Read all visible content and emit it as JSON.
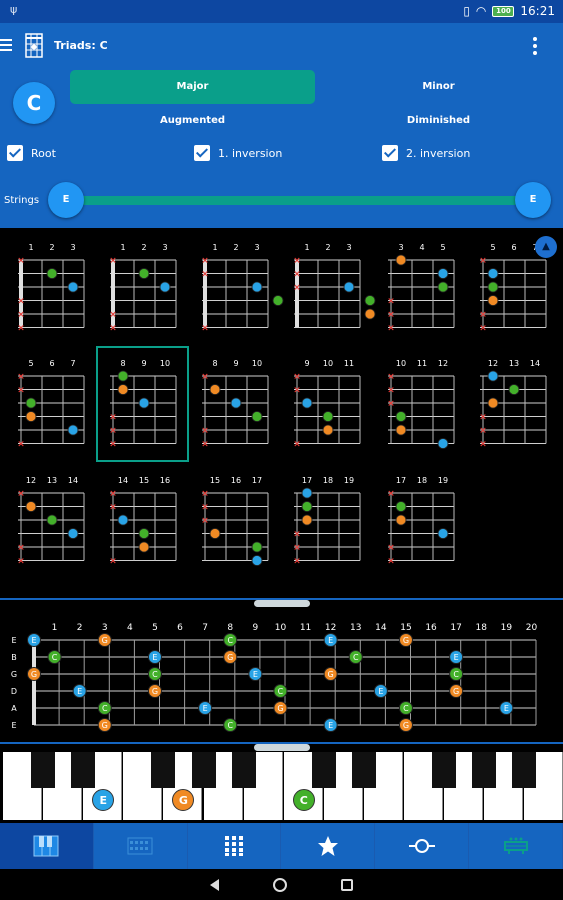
{
  "status": {
    "time": "16:21",
    "battery": "100"
  },
  "toolbar": {
    "title": "Triads: C"
  },
  "root_note": "C",
  "chord_types": [
    {
      "label": "Major",
      "active": true
    },
    {
      "label": "Minor",
      "active": false
    },
    {
      "label": "Augmented",
      "active": false
    },
    {
      "label": "Diminished",
      "active": false
    }
  ],
  "options": [
    {
      "label": "Root",
      "checked": true
    },
    {
      "label": "1. inversion",
      "checked": true
    },
    {
      "label": "2. inversion",
      "checked": true
    }
  ],
  "strings": {
    "label": "Strings",
    "from": "E",
    "to": "E"
  },
  "colors": {
    "root": "#43b02a",
    "third": "#29a3e6",
    "fifth": "#f08a24",
    "muted": "#e53935",
    "accent": "#0a9f8a",
    "primary": "#1565c0"
  },
  "diagrams": [
    {
      "frets": [
        "1",
        "2",
        "3"
      ],
      "muted": [
        0,
        3,
        4,
        5
      ],
      "nut": true,
      "dots": [
        [
          1,
          1,
          "C"
        ],
        [
          2,
          2,
          "E"
        ]
      ]
    },
    {
      "frets": [
        "1",
        "2",
        "3"
      ],
      "muted": [
        0,
        4,
        5
      ],
      "nut": true,
      "dots": [
        [
          1,
          1,
          "C"
        ],
        [
          2,
          2,
          "E"
        ]
      ]
    },
    {
      "frets": [
        "1",
        "2",
        "3"
      ],
      "muted": [
        0,
        1,
        5
      ],
      "nut": true,
      "dots": [
        [
          2,
          2,
          "E"
        ],
        [
          3,
          3,
          "C"
        ]
      ]
    },
    {
      "frets": [
        "1",
        "2",
        "3"
      ],
      "muted": [
        0,
        1,
        2
      ],
      "nut": true,
      "dots": [
        [
          2,
          2,
          "E"
        ],
        [
          3,
          3,
          "C"
        ],
        [
          4,
          3,
          "G"
        ]
      ]
    },
    {
      "frets": [
        "3",
        "4",
        "5"
      ],
      "muted": [
        3,
        4,
        5
      ],
      "nut": false,
      "dots": [
        [
          0,
          0,
          "G"
        ],
        [
          1,
          2,
          "E"
        ],
        [
          2,
          2,
          "C"
        ]
      ]
    },
    {
      "frets": [
        "5",
        "6",
        "7"
      ],
      "muted": [
        0,
        4,
        5
      ],
      "nut": false,
      "dots": [
        [
          1,
          0,
          "E"
        ],
        [
          2,
          0,
          "C"
        ],
        [
          3,
          0,
          "G"
        ]
      ]
    },
    {
      "frets": [
        "5",
        "6",
        "7"
      ],
      "muted": [
        0,
        1,
        5
      ],
      "nut": false,
      "dots": [
        [
          2,
          0,
          "C"
        ],
        [
          3,
          0,
          "G"
        ],
        [
          4,
          2,
          "E"
        ]
      ]
    },
    {
      "frets": [
        "8",
        "9",
        "10"
      ],
      "muted": [
        3,
        4,
        5
      ],
      "nut": false,
      "dots": [
        [
          0,
          0,
          "C"
        ],
        [
          1,
          0,
          "G"
        ],
        [
          2,
          1,
          "E"
        ]
      ],
      "selected": true
    },
    {
      "frets": [
        "8",
        "9",
        "10"
      ],
      "muted": [
        0,
        4,
        5
      ],
      "nut": false,
      "dots": [
        [
          1,
          0,
          "G"
        ],
        [
          2,
          1,
          "E"
        ],
        [
          3,
          2,
          "C"
        ]
      ]
    },
    {
      "frets": [
        "9",
        "10",
        "11"
      ],
      "muted": [
        0,
        1,
        5
      ],
      "nut": false,
      "dots": [
        [
          2,
          0,
          "E"
        ],
        [
          3,
          1,
          "C"
        ],
        [
          4,
          1,
          "G"
        ]
      ]
    },
    {
      "frets": [
        "10",
        "11",
        "12"
      ],
      "muted": [
        0,
        1,
        2
      ],
      "nut": false,
      "dots": [
        [
          3,
          0,
          "C"
        ],
        [
          4,
          0,
          "G"
        ],
        [
          5,
          2,
          "E"
        ]
      ]
    },
    {
      "frets": [
        "12",
        "13",
        "14"
      ],
      "muted": [
        3,
        4,
        5
      ],
      "nut": false,
      "dots": [
        [
          0,
          0,
          "E"
        ],
        [
          1,
          1,
          "C"
        ],
        [
          2,
          0,
          "G"
        ]
      ]
    },
    {
      "frets": [
        "12",
        "13",
        "14"
      ],
      "muted": [
        0,
        4,
        5
      ],
      "nut": false,
      "dots": [
        [
          1,
          0,
          "G"
        ],
        [
          2,
          1,
          "C"
        ],
        [
          3,
          2,
          "E"
        ]
      ]
    },
    {
      "frets": [
        "14",
        "15",
        "16"
      ],
      "muted": [
        0,
        1,
        5
      ],
      "nut": false,
      "dots": [
        [
          2,
          0,
          "E"
        ],
        [
          3,
          1,
          "C"
        ],
        [
          4,
          1,
          "G"
        ]
      ]
    },
    {
      "frets": [
        "15",
        "16",
        "17"
      ],
      "muted": [
        0,
        1,
        2
      ],
      "nut": false,
      "dots": [
        [
          3,
          0,
          "G"
        ],
        [
          4,
          2,
          "C"
        ],
        [
          5,
          2,
          "E"
        ]
      ]
    },
    {
      "frets": [
        "17",
        "18",
        "19"
      ],
      "muted": [
        3,
        4,
        5
      ],
      "nut": false,
      "dots": [
        [
          0,
          0,
          "E"
        ],
        [
          1,
          0,
          "C"
        ],
        [
          2,
          0,
          "G"
        ]
      ]
    },
    {
      "frets": [
        "17",
        "18",
        "19"
      ],
      "muted": [
        0,
        4,
        5
      ],
      "nut": false,
      "dots": [
        [
          1,
          0,
          "C"
        ],
        [
          2,
          0,
          "G"
        ],
        [
          3,
          2,
          "E"
        ]
      ]
    }
  ],
  "fretboard": {
    "strings": [
      "E",
      "B",
      "G",
      "D",
      "A",
      "E"
    ],
    "frets": [
      "1",
      "2",
      "3",
      "4",
      "5",
      "6",
      "7",
      "8",
      "9",
      "10",
      "11",
      "12",
      "13",
      "14",
      "15",
      "16",
      "17",
      "18",
      "19",
      "20"
    ],
    "notes": [
      [
        0,
        0,
        "E"
      ],
      [
        0,
        3,
        "G"
      ],
      [
        0,
        8,
        "C"
      ],
      [
        0,
        12,
        "E"
      ],
      [
        0,
        15,
        "G"
      ],
      [
        1,
        1,
        "C"
      ],
      [
        1,
        5,
        "E"
      ],
      [
        1,
        8,
        "G"
      ],
      [
        1,
        13,
        "C"
      ],
      [
        1,
        17,
        "E"
      ],
      [
        2,
        0,
        "G"
      ],
      [
        2,
        5,
        "C"
      ],
      [
        2,
        9,
        "E"
      ],
      [
        2,
        12,
        "G"
      ],
      [
        2,
        17,
        "C"
      ],
      [
        3,
        2,
        "E"
      ],
      [
        3,
        5,
        "G"
      ],
      [
        3,
        10,
        "C"
      ],
      [
        3,
        14,
        "E"
      ],
      [
        3,
        17,
        "G"
      ],
      [
        4,
        3,
        "C"
      ],
      [
        4,
        7,
        "E"
      ],
      [
        4,
        10,
        "G"
      ],
      [
        4,
        15,
        "C"
      ],
      [
        4,
        19,
        "E"
      ],
      [
        5,
        3,
        "G"
      ],
      [
        5,
        8,
        "C"
      ],
      [
        5,
        12,
        "E"
      ],
      [
        5,
        15,
        "G"
      ]
    ]
  },
  "piano": {
    "notes": [
      {
        "label": "E",
        "key": 2
      },
      {
        "label": "G",
        "key": 4
      },
      {
        "label": "C",
        "key": 7
      }
    ]
  },
  "nav": [
    "piano",
    "keyboard-grid",
    "dots-grid",
    "favorites",
    "chord-circle",
    "guitar"
  ]
}
